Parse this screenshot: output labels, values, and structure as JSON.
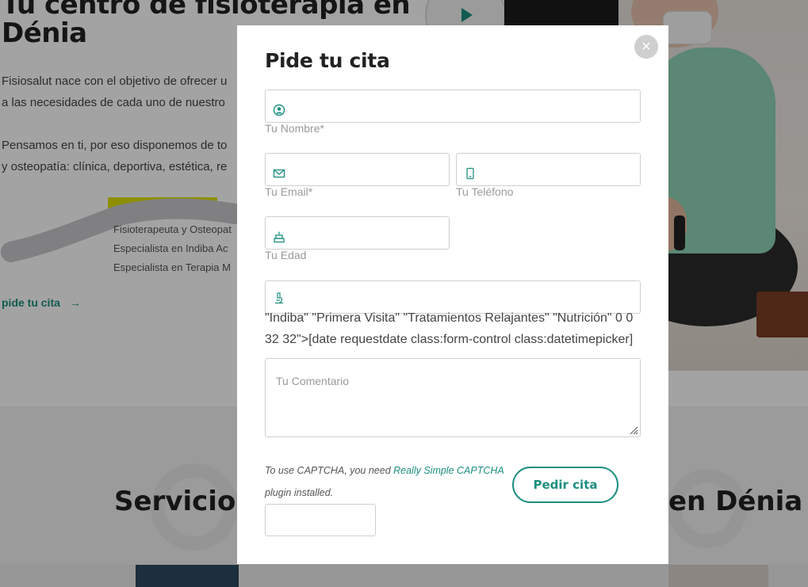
{
  "background": {
    "hero_title_line1": "Tu centro de fisioterapia en",
    "hero_title_line2": "Dénia",
    "intro_line1": "Fisiosalut nace con el objetivo de ofrecer u",
    "intro_line2": "a las necesidades de cada uno de nuestro",
    "intro_line3": "Pensamos en ti, por eso disponemos de to",
    "intro_line4": "y osteopatía: clínica, deportiva, estética, re",
    "team_line1": "Fisioterapeuta y Osteopat",
    "team_line2": "Especialista en Indiba Ac",
    "team_line3": "Especialista en Terapia M",
    "cta_label": "pide tu cita",
    "cta_arrow": "→",
    "section_left": "Servicios",
    "section_right": "en Dénia",
    "play_icon": "play-icon"
  },
  "modal": {
    "title": "Pide tu cita",
    "close_label": "×",
    "name_label": "Tu Nombre*",
    "email_label": "Tu Email*",
    "phone_label": "Tu Teléfono",
    "age_label": "Tu Edad",
    "stray_line1": "\"Indiba\" \"Primera Visita\" \"Tratamientos Relajantes\" \"Nutrición\" 0 0",
    "stray_line2": "32 32\">[date requestdate class:form-control class:datetimepicker]",
    "comment_placeholder": "Tu Comentario",
    "captcha_prefix": "To use CAPTCHA, you need ",
    "captcha_link": "Really Simple CAPTCHA",
    "captcha_suffix": "plugin installed.",
    "submit_label": "Pedir cita"
  },
  "colors": {
    "accent": "#1d8f7f",
    "overlay": "rgba(0,0,0,0.36)",
    "highlight": "#dfe000"
  }
}
